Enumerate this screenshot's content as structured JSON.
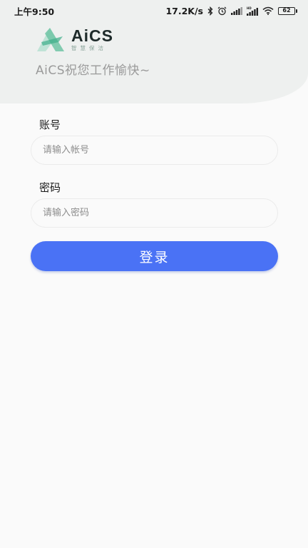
{
  "status_bar": {
    "time": "上午9:50",
    "network_speed": "17.2K/s",
    "battery_level": "62",
    "icons": [
      "bluetooth-icon",
      "alarm-icon",
      "signal-icon",
      "hd-signal-icon",
      "wifi-icon",
      "battery-icon"
    ]
  },
  "header": {
    "logo_title": "AiCS",
    "logo_subtitle": "智慧保洁",
    "welcome_text": "AiCS祝您工作愉快~",
    "background_color": "#eef0ef"
  },
  "form": {
    "account_label": "账号",
    "account_placeholder": "请输入帐号",
    "account_value": "",
    "password_label": "密码",
    "password_placeholder": "请输入密码",
    "password_value": "",
    "login_button_label": "登录",
    "login_button_color": "#4a72f5"
  }
}
